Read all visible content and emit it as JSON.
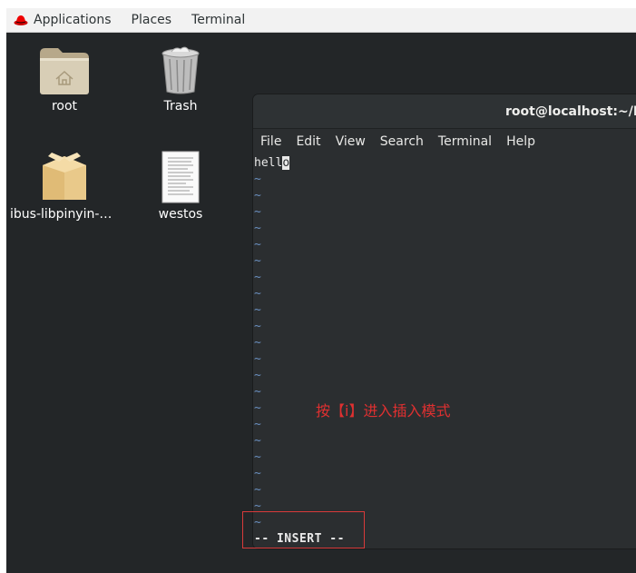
{
  "topbar": {
    "items": [
      "Applications",
      "Places",
      "Terminal"
    ]
  },
  "desktop": {
    "icons": [
      {
        "label": "root",
        "icon": "home-folder-icon"
      },
      {
        "label": "Trash",
        "icon": "trash-icon"
      },
      {
        "label": "ibus-libpinyin-1....",
        "icon": "package-icon"
      },
      {
        "label": "westos",
        "icon": "text-file-icon"
      }
    ]
  },
  "terminal": {
    "title": "root@localhost:~/Des",
    "menu": [
      "File",
      "Edit",
      "View",
      "Search",
      "Terminal",
      "Help"
    ],
    "text_before_cursor": "hell",
    "cursor_char": "o",
    "tilde": "~",
    "tilde_count": 22,
    "mode_line": "-- INSERT --"
  },
  "annotation": {
    "text": "按【i】进入插入模式",
    "color": "#e03030"
  },
  "colors": {
    "desktop_bg": "#232628",
    "terminal_bg": "#2b2e30",
    "tilde": "#6a8fbf",
    "highlight_box": "#d83a3a"
  }
}
